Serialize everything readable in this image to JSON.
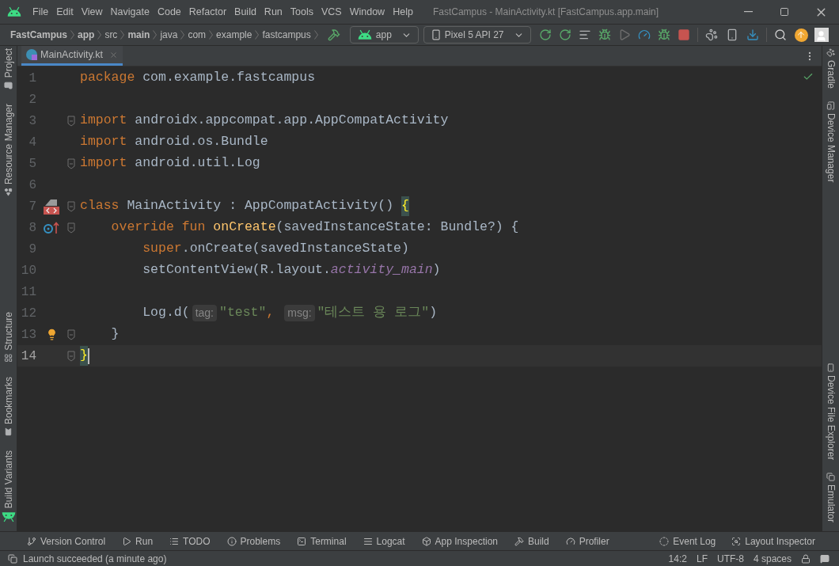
{
  "window": {
    "title": "FastCampus - MainActivity.kt [FastCampus.app.main]"
  },
  "menu": [
    "File",
    "Edit",
    "View",
    "Navigate",
    "Code",
    "Refactor",
    "Build",
    "Run",
    "Tools",
    "VCS",
    "Window",
    "Help"
  ],
  "breadcrumbs": [
    {
      "label": "FastCampus",
      "bold": true
    },
    {
      "label": "app",
      "bold": true
    },
    {
      "label": "src",
      "bold": false
    },
    {
      "label": "main",
      "bold": true
    },
    {
      "label": "java",
      "bold": false
    },
    {
      "label": "com",
      "bold": false
    },
    {
      "label": "example",
      "bold": false
    },
    {
      "label": "fastcampus",
      "bold": false
    }
  ],
  "run_config": "app",
  "device": "Pixel 5 API 27",
  "left_toolbar": {
    "top": [
      "Project",
      "Resource Manager"
    ],
    "bottom": [
      "Structure",
      "Bookmarks",
      "Build Variants"
    ]
  },
  "right_toolbar": {
    "top": [
      "Gradle",
      "Device Manager"
    ],
    "bottom": [
      "Device File Explorer",
      "Emulator"
    ]
  },
  "tabs": [
    {
      "label": "MainActivity.kt",
      "selected": true
    }
  ],
  "editor": {
    "lines": [
      {
        "number": "1",
        "current": false,
        "fold": false,
        "tokens": [
          {
            "kind": "keyword",
            "text": "package"
          },
          {
            "kind": "plain",
            "text": " com.example.fastcampus"
          }
        ]
      },
      {
        "number": "2",
        "current": false,
        "fold": false
      },
      {
        "number": "3",
        "current": false,
        "fold": true,
        "tokens": [
          {
            "kind": "keyword",
            "text": "import"
          },
          {
            "kind": "plain",
            "text": " androidx.appcompat.app.AppCompatActivity"
          }
        ]
      },
      {
        "number": "4",
        "current": false,
        "fold": false,
        "tokens": [
          {
            "kind": "keyword",
            "text": "import"
          },
          {
            "kind": "plain",
            "text": " android.os.Bundle"
          }
        ]
      },
      {
        "number": "5",
        "current": false,
        "fold": true,
        "tokens": [
          {
            "kind": "keyword",
            "text": "import"
          },
          {
            "kind": "plain",
            "text": " android.util.Log"
          }
        ]
      },
      {
        "number": "6",
        "current": false,
        "fold": false
      },
      {
        "number": "7",
        "current": false,
        "fold": true,
        "tokens": [
          {
            "kind": "keyword",
            "text": "class"
          },
          {
            "kind": "plain",
            "text": " MainActivity : AppCompatActivity() "
          },
          {
            "kind": "brace-match",
            "text": "{"
          }
        ]
      },
      {
        "number": "8",
        "current": false,
        "fold": true,
        "tokens": [
          {
            "kind": "keyword",
            "text": "    override fun "
          },
          {
            "kind": "function",
            "text": "onCreate"
          },
          {
            "kind": "plain",
            "text": "(savedInstanceState: Bundle?) {"
          }
        ]
      },
      {
        "number": "9",
        "current": false,
        "fold": false,
        "tokens": [
          {
            "kind": "keyword",
            "text": "        super"
          },
          {
            "kind": "plain",
            "text": ".onCreate(savedInstanceState)"
          }
        ]
      },
      {
        "number": "10",
        "current": false,
        "fold": false,
        "tokens": [
          {
            "kind": "plain",
            "text": "        setContentView(R.layout."
          },
          {
            "kind": "field",
            "text": "activity_main"
          },
          {
            "kind": "plain",
            "text": ")"
          }
        ]
      },
      {
        "number": "11",
        "current": false,
        "fold": false
      },
      {
        "number": "12",
        "current": false,
        "fold": false,
        "tokens": [
          {
            "kind": "plain",
            "text": "        Log.d("
          },
          {
            "kind": "hint",
            "text": "tag:"
          },
          {
            "kind": "string",
            "text": "\"test\""
          },
          {
            "kind": "keyword",
            "text": ", "
          },
          {
            "kind": "hint",
            "text": "msg:"
          },
          {
            "kind": "string",
            "text": "\"테스트 용 로그\""
          },
          {
            "kind": "plain",
            "text": ")"
          }
        ]
      },
      {
        "number": "13",
        "current": false,
        "fold": true,
        "tokens": [
          {
            "kind": "plain",
            "text": "    }"
          }
        ]
      },
      {
        "number": "14",
        "current": true,
        "fold": true,
        "tokens": [
          {
            "kind": "brace-match",
            "text": "}"
          }
        ]
      }
    ]
  },
  "bottom_tools": {
    "left": [
      "Version Control",
      "Run",
      "TODO",
      "Problems",
      "Terminal",
      "Logcat",
      "App Inspection",
      "Build",
      "Profiler"
    ],
    "right": [
      "Event Log",
      "Layout Inspector"
    ]
  },
  "status_bar": {
    "message": "Launch succeeded (a minute ago)",
    "position": "14:2",
    "line_separator": "LF",
    "encoding": "UTF-8",
    "indent": "4 spaces"
  }
}
